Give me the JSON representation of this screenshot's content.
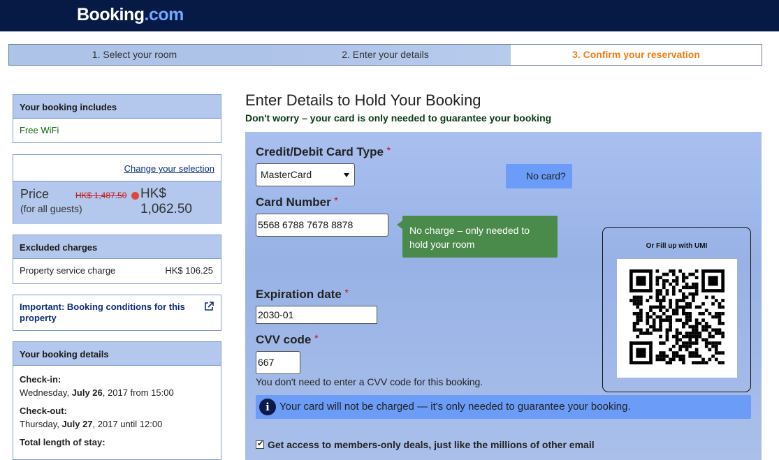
{
  "header": {
    "logo_main": "Booking",
    "logo_dot": ".com"
  },
  "steps": [
    {
      "label": "1. Select your room"
    },
    {
      "label": "2. Enter your details"
    },
    {
      "label": "3. Confirm your reservation"
    }
  ],
  "sidebar": {
    "includes": {
      "title": "Your booking includes",
      "item": "Free WiFi"
    },
    "price": {
      "change_link": "Change your selection",
      "label": "Price",
      "sub": "(for all guests)",
      "old": "HK$ 1,487.50",
      "new": "HK$ 1,062.50"
    },
    "excluded": {
      "title": "Excluded charges",
      "item_label": "Property service charge",
      "item_value": "HK$ 106.25"
    },
    "important": {
      "text": "Important: Booking conditions for this property"
    },
    "details": {
      "title": "Your booking details",
      "checkin_label": "Check-in:",
      "checkin_day": "Wednesday, ",
      "checkin_date": "July 26",
      "checkin_rest": ", 2017 from 15:00",
      "checkout_label": "Check-out:",
      "checkout_day": "Thursday, ",
      "checkout_date": "July 27",
      "checkout_rest": ", 2017 until 12:00",
      "length_label": "Total length of stay:"
    }
  },
  "main": {
    "title": "Enter Details to Hold Your Booking",
    "subtitle": "Don't worry – your card is only needed to guarantee your booking",
    "card_type_label": "Credit/Debit Card Type",
    "card_type_value": "MasterCard",
    "no_card_button": "No card?",
    "card_number_label": "Card Number",
    "card_number_value": "5568 6788 7678 8878",
    "tooltip": "No charge – only needed to hold your room",
    "umi_title": "Or Fill up with UMI",
    "expiry_label": "Expiration date",
    "expiry_value": "2030-01",
    "cvv_label": "CVV code",
    "cvv_value": "667",
    "cvv_note": "You don't need to enter a CVV code for this booking.",
    "info_text": "Your card will not be charged — it's only needed to guarantee your booking.",
    "checkbox_label": "Get access to members-only deals, just like the millions of other email",
    "required_mark": "*",
    "info_glyph": "i"
  },
  "colors": {
    "brand_dark": "#061a45",
    "accent_orange": "#f07e13",
    "form_blue": "#a9bff0",
    "button_blue": "#6a9cf8",
    "tooltip_green": "#4a8a4a"
  }
}
